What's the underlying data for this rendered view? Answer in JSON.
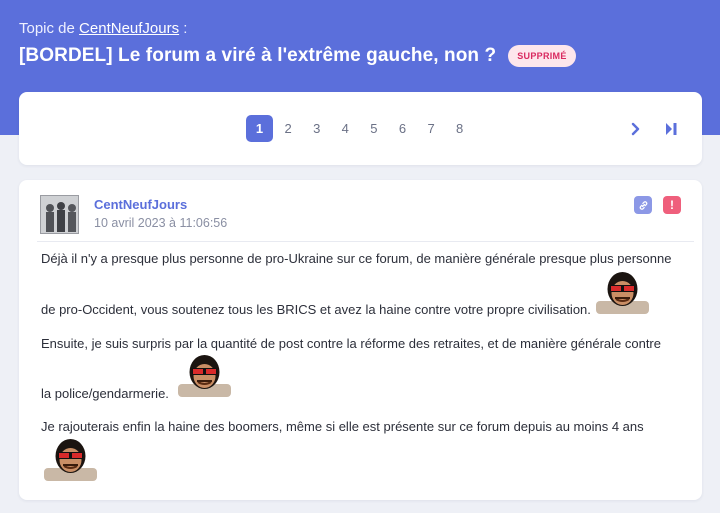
{
  "header": {
    "topic_prefix": "Topic de",
    "topic_author": "CentNeufJours",
    "topic_suffix": " :",
    "title": "[BORDEL] Le forum a viré à l'extrême gauche, non ?",
    "status_badge": "SUPPRIMÉ"
  },
  "pagination": {
    "pages": [
      "1",
      "2",
      "3",
      "4",
      "5",
      "6",
      "7",
      "8"
    ],
    "current": "1",
    "next_icon": "chevron-right-icon",
    "last_icon": "last-page-icon"
  },
  "post": {
    "author": "CentNeufJours",
    "date": "10 avril 2023 à 11:06:56",
    "lines": [
      "Déjà il n'y a presque plus personne de pro-Ukraine sur ce forum, de manière générale presque plus personne",
      "de pro-Occident, vous soutenez tous les BRICS et avez la haine contre votre propre civilisation.",
      "Ensuite, je suis surpris par la quantité de post contre la réforme des retraites, et de manière générale contre",
      "la police/gendarmerie.",
      "Je rajouterais enfin la haine des boomers, même si elle est présente sur ce forum depuis au moins 4 ans"
    ],
    "actions": {
      "link_icon": "link-icon",
      "report_icon": "alert-icon",
      "report_glyph": "!"
    },
    "sticker_icon": "sunglasses-man-sticker-icon"
  },
  "colors": {
    "hero": "#5b6fdb",
    "accent": "#5b6fdb",
    "badge_bg": "#fde6ec",
    "badge_text": "#d9295f",
    "report": "#ef5f7c",
    "link_btn": "#8c98e6"
  }
}
